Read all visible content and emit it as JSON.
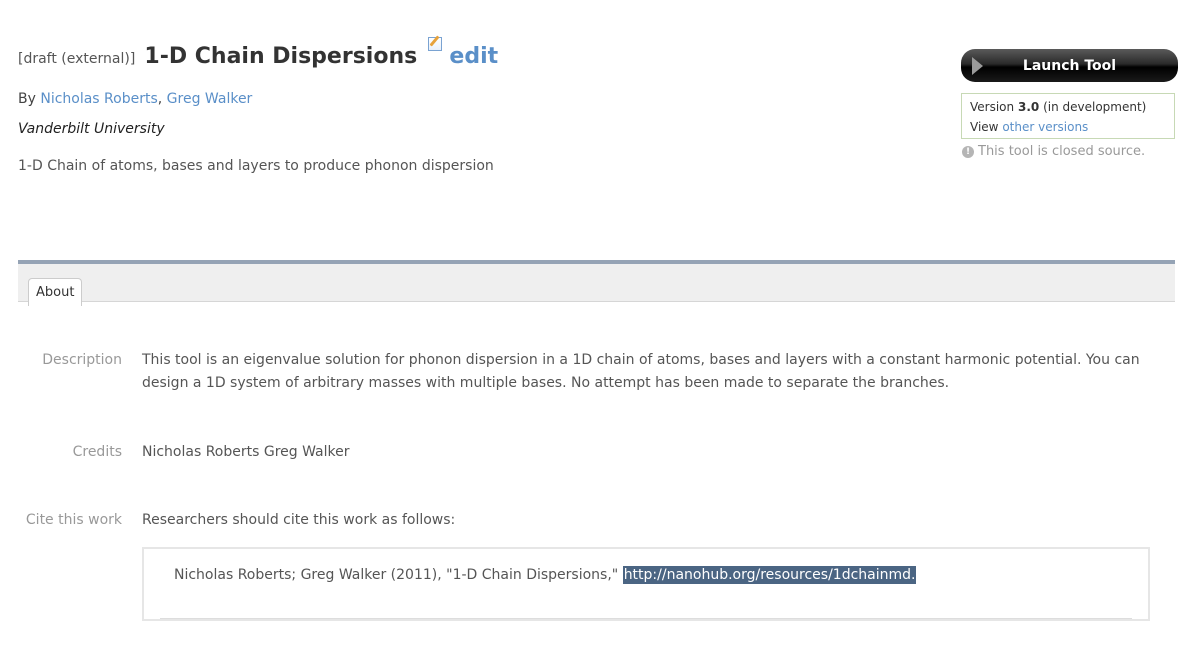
{
  "header": {
    "draft_label": "[draft (external)]",
    "title": "1-D Chain Dispersions",
    "edit_label": "edit",
    "by_label": "By",
    "authors": [
      "Nicholas Roberts",
      "Greg Walker"
    ],
    "author_separator": ", ",
    "organization": "Vanderbilt University",
    "summary": "1-D Chain of atoms, bases and layers to produce phonon dispersion"
  },
  "sidebar": {
    "launch_label": "Launch Tool",
    "version_prefix": "Version",
    "version_number": "3.0",
    "version_status": "(in development)",
    "view_prefix": "View",
    "other_versions_label": "other versions",
    "closed_source_text": "This tool is closed source."
  },
  "tabs": [
    {
      "label": "About",
      "active": true
    }
  ],
  "about": {
    "description_label": "Description",
    "description": "This tool is an eigenvalue solution for phonon dispersion in a 1D chain of atoms, bases and layers with a constant harmonic potential. You can design a 1D system of arbitrary masses with multiple bases. No attempt has been made to separate the branches.",
    "credits_label": "Credits",
    "credits": "Nicholas Roberts Greg Walker",
    "cite_label": "Cite this work",
    "cite_intro": "Researchers should cite this work as follows:",
    "citation_text": "Nicholas Roberts; Greg Walker (2011), \"1-D Chain Dispersions,\"",
    "citation_url": "http://nanohub.org/resources/1dchainmd."
  },
  "colors": {
    "link": "#5a8fc8",
    "tabbar_accent": "#95a3b5",
    "selection_highlight": "#4b6583"
  }
}
